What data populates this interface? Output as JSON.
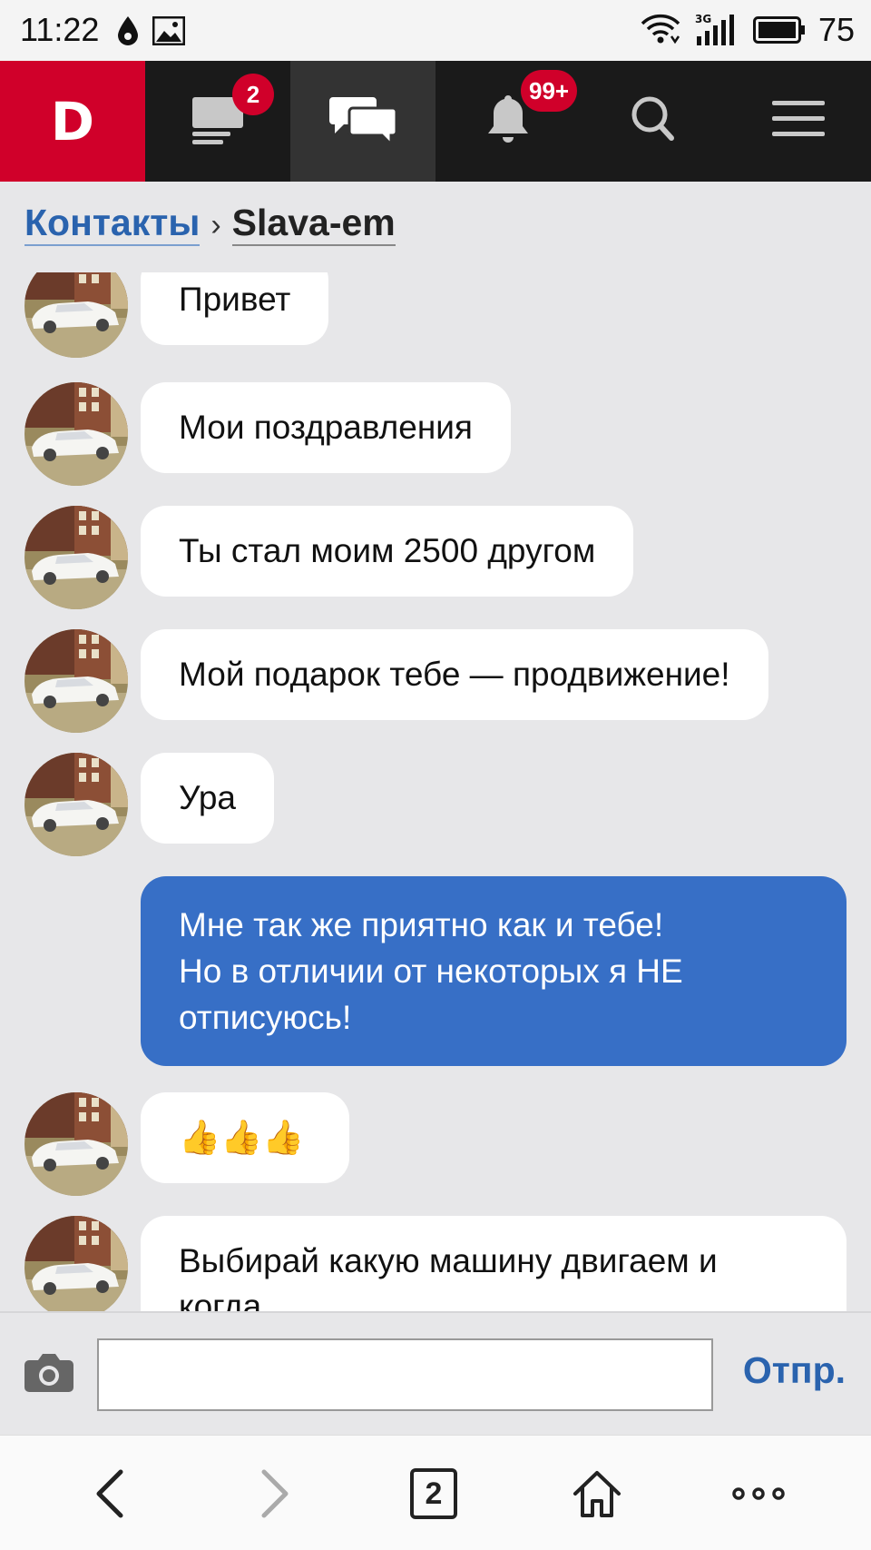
{
  "status_bar": {
    "time": "11:22",
    "network": "3G",
    "battery": "75",
    "icons": [
      "drop-icon",
      "image-icon",
      "wifi-icon",
      "signal-icon",
      "battery-icon"
    ]
  },
  "nav": {
    "logo": "D",
    "feed_badge": "2",
    "notifications_badge": "99+",
    "icons": [
      "feed-icon",
      "chat-icon",
      "bell-icon",
      "search-icon",
      "menu-icon"
    ],
    "colors": {
      "brand": "#d0002a",
      "bar": "#1a1a1a",
      "active": "#333333"
    }
  },
  "breadcrumb": {
    "parent": "Контакты",
    "separator": "›",
    "current": "Slava-em"
  },
  "messages": [
    {
      "text": "Привет",
      "from": "them"
    },
    {
      "text": "Мои поздравления",
      "from": "them"
    },
    {
      "text": "Ты стал моим 2500 другом",
      "from": "them"
    },
    {
      "text": "Мой подарок тебе — продвижение!",
      "from": "them"
    },
    {
      "text": "Ура",
      "from": "them"
    },
    {
      "lines": [
        "Мне так же приятно как и тебе!",
        "Но в отличии от некоторых я НЕ",
        "отписуюсь!"
      ],
      "from": "me"
    },
    {
      "emoji": "👍👍👍",
      "from": "them"
    },
    {
      "lines": [
        "Выбирай какую машину двигаем и",
        "когда"
      ],
      "from": "them"
    }
  ],
  "composer": {
    "input_value": "",
    "send_label": "Отпр.",
    "camera_icon": "camera-icon"
  },
  "browser_bar": {
    "tabs_count": "2",
    "icons": [
      "back-icon",
      "forward-icon",
      "tabs-icon",
      "home-icon",
      "more-icon"
    ]
  },
  "colors": {
    "accent": "#2a63ae",
    "outgoing_bubble": "#376fc6",
    "background": "#e7e7e9"
  }
}
